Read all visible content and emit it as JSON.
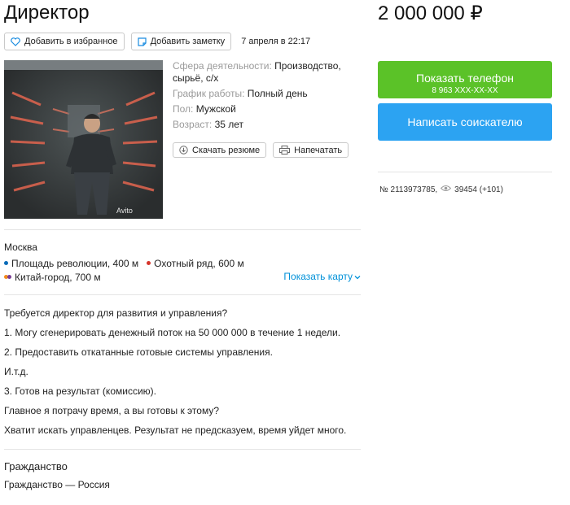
{
  "title": "Директор",
  "price": "2 000 000 ₽",
  "toolbar": {
    "favorite_label": "Добавить в избранное",
    "note_label": "Добавить заметку",
    "date": "7 апреля в 22:17"
  },
  "params": [
    {
      "label": "Сфера деятельности:",
      "value": "Производство, сырьё, с/х"
    },
    {
      "label": "График работы:",
      "value": "Полный день"
    },
    {
      "label": "Пол:",
      "value": "Мужской"
    },
    {
      "label": "Возраст:",
      "value": "35 лет"
    }
  ],
  "resume_actions": {
    "download_label": "Скачать резюме",
    "print_label": "Напечатать"
  },
  "photo": {
    "watermark": "Avito"
  },
  "location": {
    "city": "Москва",
    "metro": [
      {
        "name": "Площадь революции, 400 м",
        "colors": [
          "#0a6bb8"
        ]
      },
      {
        "name": "Охотный ряд, 600 м",
        "colors": [
          "#d6352b"
        ]
      },
      {
        "name": "Китай-город, 700 м",
        "colors": [
          "#f28b1c",
          "#7a3d94"
        ]
      }
    ],
    "show_map_label": "Показать карту"
  },
  "description": [
    "Требуется директор для развития и управления?",
    "1. Могу сгенерировать денежный поток на 50 000 000 в течение 1 недели.",
    "2. Предоставить откатанные готовые системы управления.",
    "И.т.д.",
    "3. Готов на результат (комиссию).",
    "Главное я потрачу время, а вы готовы к этому?",
    "Хватит искать управленцев. Результат не предсказуем, время уйдет много."
  ],
  "citizenship": {
    "heading": "Гражданство",
    "value": "Гражданство — Россия"
  },
  "contact": {
    "phone_label": "Показать телефон",
    "phone_masked": "8 963 XXX-XX-XX",
    "write_label": "Написать соискателю"
  },
  "meta": {
    "ad_number": "№ 2113973785,",
    "views": "39454 (+101)"
  },
  "colors": {
    "phone_button": "#5bc228",
    "write_button": "#2ca3f2",
    "link": "#0091d9"
  },
  "icons": [
    "heart-icon",
    "note-icon",
    "download-icon",
    "printer-icon",
    "eye-icon",
    "chevron-down-icon"
  ]
}
